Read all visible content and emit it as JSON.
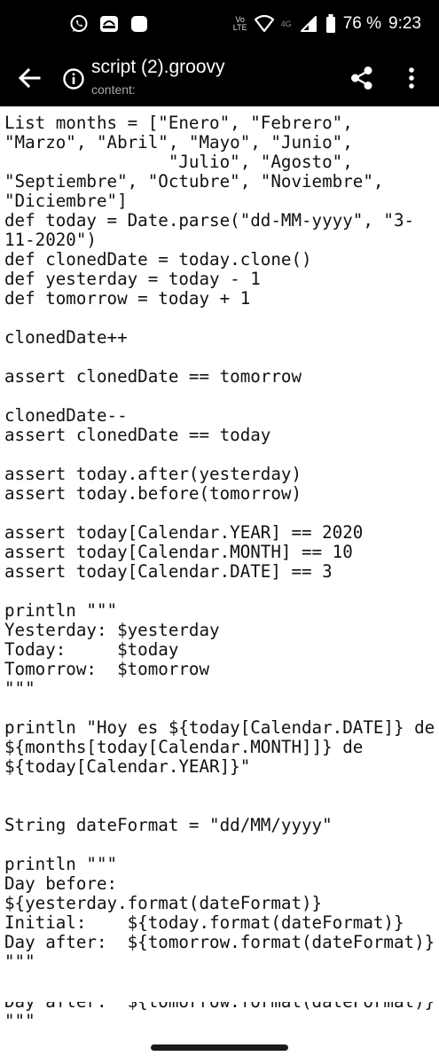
{
  "status_bar": {
    "left_icons": [
      "whatsapp-icon",
      "notification-icon",
      "app-icon"
    ],
    "volte_label": "Vo LTE",
    "network_label": "4G",
    "battery_percent": "76 %",
    "time": "9:23"
  },
  "app_bar": {
    "title": "script (2).groovy",
    "subtitle": "content:"
  },
  "code_lines": [
    "List months = [\"Enero\", \"Febrero\",",
    "\"Marzo\", \"Abril\", \"Mayo\", \"Junio\",",
    "                \"Julio\", \"Agosto\",",
    "\"Septiembre\", \"Octubre\", \"Noviembre\",",
    "\"Diciembre\"]",
    "def today = Date.parse(\"dd-MM-yyyy\", \"3-",
    "11-2020\")",
    "def clonedDate = today.clone()",
    "def yesterday = today - 1",
    "def tomorrow = today + 1",
    "",
    "clonedDate++",
    "",
    "assert clonedDate == tomorrow",
    "",
    "clonedDate--",
    "assert clonedDate == today",
    "",
    "assert today.after(yesterday)",
    "assert today.before(tomorrow)",
    "",
    "assert today[Calendar.YEAR] == 2020",
    "assert today[Calendar.MONTH] == 10",
    "assert today[Calendar.DATE] == 3",
    "",
    "println \"\"\"",
    "Yesterday: $yesterday",
    "Today:     $today",
    "Tomorrow:  $tomorrow",
    "\"\"\"",
    "",
    "println \"Hoy es ${today[Calendar.DATE]} de",
    "${months[today[Calendar.MONTH]]} de",
    "${today[Calendar.YEAR]}\"",
    "",
    "",
    "String dateFormat = \"dd/MM/yyyy\"",
    "",
    "println \"\"\"",
    "Day before:",
    "${yesterday.format(dateFormat)}",
    "Initial:    ${today.format(dateFormat)}",
    "Day after:  ${tomorrow.format(dateFormat)}",
    "\"\"\""
  ],
  "peek_lines": [
    "Day after:  ${tomorrow.format(dateFormat)}",
    "\"\"\""
  ]
}
